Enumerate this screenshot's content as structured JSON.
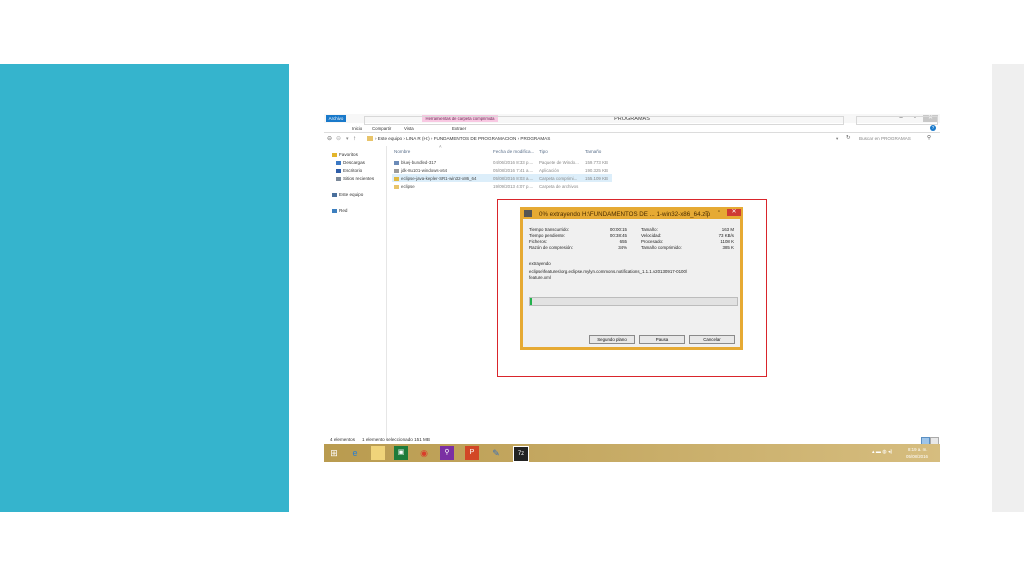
{
  "window": {
    "title": "PROGRAMAS",
    "context_tab": "Herramientas de carpeta comprimida",
    "minimize_glyph": "–",
    "maximize_glyph": "▫",
    "close_glyph": "✕"
  },
  "ribbon": {
    "tabs": [
      "Archivo",
      "Inicio",
      "Compartir",
      "Vista",
      "Extraer"
    ],
    "help_glyph": "?"
  },
  "address": {
    "path": "› Este equipo › LINA R (H:) › FUNDAMENTOS DE PROGRAMACION › PROGRAMAS",
    "search_placeholder": "Buscar en PROGRAMAS"
  },
  "nav": {
    "favorites": "Favoritos",
    "items": [
      "Descargas",
      "Escritorio",
      "Sitios recientes"
    ],
    "this_pc": "Este equipo",
    "network": "Red"
  },
  "file_list": {
    "columns": [
      "Nombre",
      "Fecha de modifica...",
      "Tipo",
      "Tamaño"
    ],
    "rows": [
      {
        "name": "bluej-bundled-317",
        "date": "04/06/2016 8:33 p....",
        "type": "Paquete de Windo...",
        "size": "159.773 KB"
      },
      {
        "name": "jdk-8u101-windows-x64",
        "date": "05/08/2016 7:41 a....",
        "type": "Aplicación",
        "size": "190.325 KB"
      },
      {
        "name": "eclipse-java-kepler-SR1-win32-x86_64",
        "date": "05/08/2016 8:03 a....",
        "type": "Carpeta comprimi...",
        "size": "155.109 KB"
      },
      {
        "name": "eclipse",
        "date": "19/09/2013 4:07 p....",
        "type": "Carpeta de archivos",
        "size": ""
      }
    ]
  },
  "status": {
    "count": "4 elementos",
    "selection": "1 elemento seleccionado 151 MB"
  },
  "dialog": {
    "title": "0% extrayendo H:\\FUNDAMENTOS DE ... 1-win32-x86_64.zip",
    "left_labels": [
      "Tiempo transcurrido:",
      "Tiempo pendiente:",
      "Ficheros:",
      "Razón de compresión:"
    ],
    "left_values": [
      "00:00:15",
      "00:38:45",
      "655",
      "34%"
    ],
    "right_labels": [
      "Tamaño:",
      "Velocidad:",
      "Procesado:",
      "Tamaño comprimido:"
    ],
    "right_values": [
      "163 M",
      "73 KB/s",
      "1108 K",
      "385 K"
    ],
    "status_label": "extrayendo",
    "current_file_1": "eclipse\\features\\org.eclipse.mylyn.commons.notifications_1.1.1.v20130917-0100\\",
    "current_file_2": "feature.xml",
    "progress": 0.01,
    "buttons": [
      "Segundo plano",
      "Pausa",
      "Cancelar"
    ]
  },
  "taskbar": {
    "apps": [
      "windows-logo",
      "ie",
      "file-explorer",
      "excel-like",
      "chrome",
      "search",
      "powerpoint",
      "paint",
      "7zip"
    ],
    "app7z_label": "7z",
    "time": "8:19 a. m.",
    "date": "05/08/2016"
  },
  "colors": {
    "teal_panel": "#35b4cd",
    "dialog_frame": "#e6aa34",
    "highlight_border": "#d9252b",
    "taskbar": "#c9ad66",
    "archivo_tab": "#1979ca"
  }
}
